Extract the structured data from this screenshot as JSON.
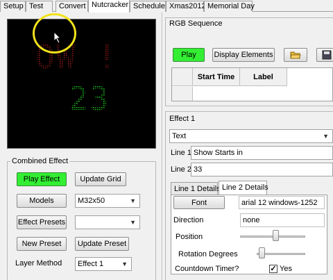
{
  "tabs": [
    "Setup",
    "Test",
    "Convert",
    "Nutcracker",
    "Schedule",
    "Xmas2012",
    "Memorial Day"
  ],
  "active_tab": "Nutcracker",
  "preview": {
    "line1_text": "OW !",
    "line2_text": "23",
    "line1_color": "#7a1414",
    "line2_color": "#16a816"
  },
  "combined_effect": {
    "title": "Combined Effect",
    "play_effect": "Play Effect",
    "update_grid": "Update Grid",
    "models_label": "Models",
    "models_value": "M32x50",
    "effect_presets_label": "Effect Presets",
    "effect_presets_value": "",
    "new_preset": "New Preset",
    "update_preset": "Update Preset",
    "layer_method_label": "Layer Method",
    "layer_method_value": "Effect 1"
  },
  "rgb_sequence": {
    "title": "RGB Sequence",
    "play": "Play",
    "display_elements": "Display Elements",
    "col_start_time": "Start Time",
    "col_label": "Label"
  },
  "effect1": {
    "title": "Effect 1",
    "type_value": "Text",
    "line1_label": "Line 1",
    "line1_value": "Show Starts in",
    "line2_label": "Line 2",
    "line2_value": "33",
    "subtab1": "Line 1 Details",
    "subtab2": "Line 2 Details",
    "font_button": "Font",
    "font_value": "arial 12 windows-1252",
    "direction_label": "Direction",
    "direction_value": "none",
    "position_label": "Position",
    "position_level": 0.55,
    "rotation_label": "Rotation Degrees",
    "rotation_level": 0.05,
    "countdown_label": "Countdown Timer?",
    "countdown_checked": "✓",
    "countdown_value": "Yes"
  },
  "colors": {
    "green_button": "#33ee33",
    "highlight_ring": "#f2e21b"
  }
}
